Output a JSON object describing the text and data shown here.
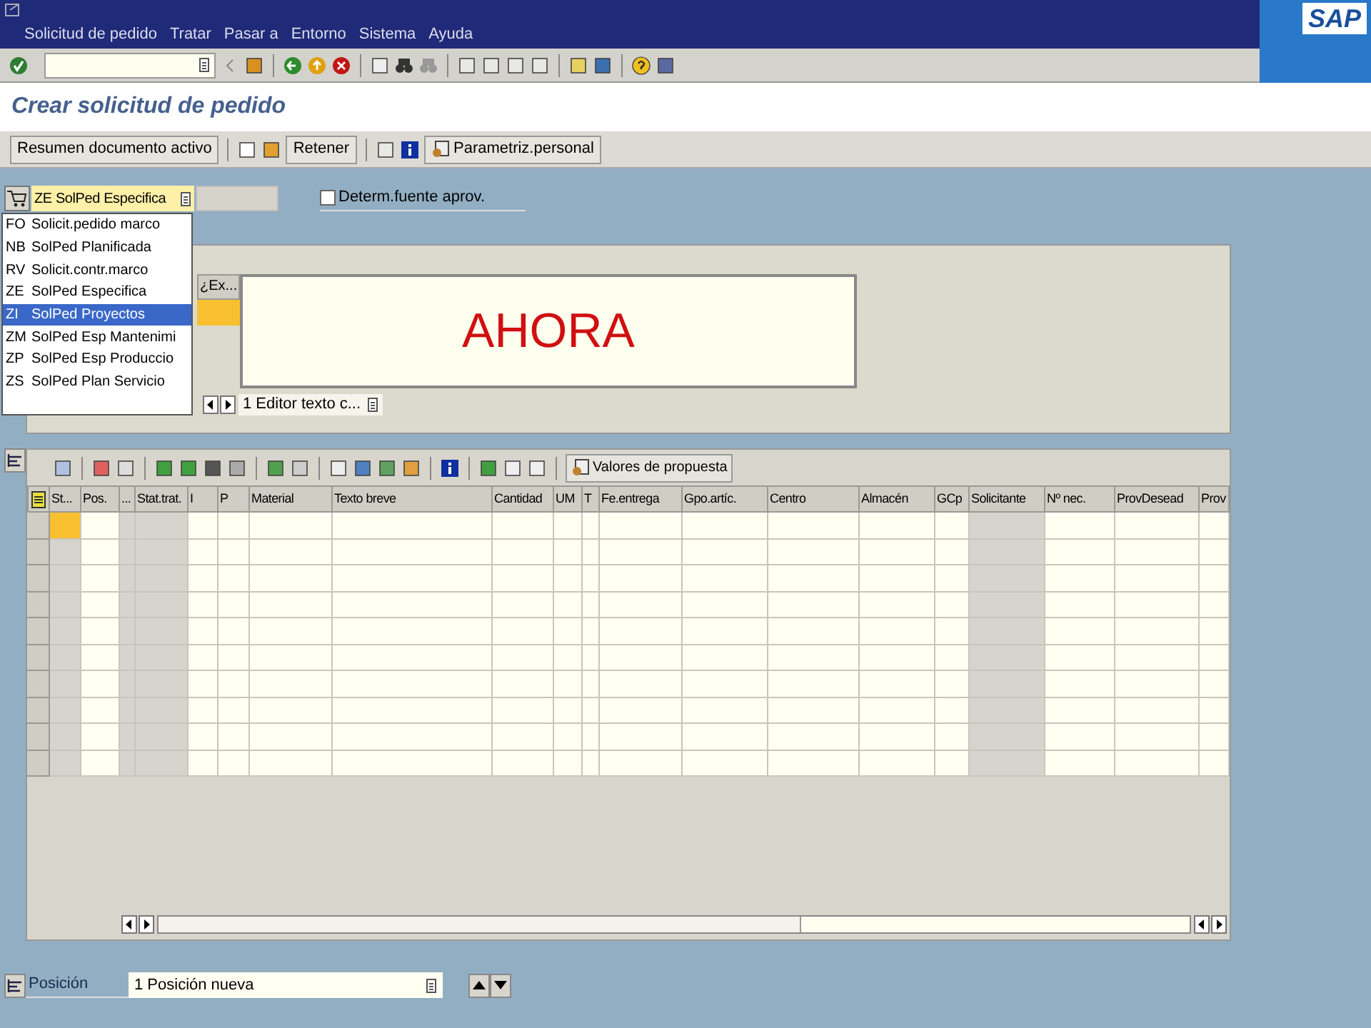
{
  "logo": "SAP",
  "menu": [
    {
      "label": "Solicitud de pedido"
    },
    {
      "label": "Tratar"
    },
    {
      "label": "Pasar a"
    },
    {
      "label": "Entorno"
    },
    {
      "label": "Sistema"
    },
    {
      "label": "Ayuda"
    }
  ],
  "title": "Crear solicitud de pedido",
  "app_toolbar": {
    "summary_button": "Resumen documento activo",
    "hold_button": "Retener",
    "settings_button": "Parametriz.personal"
  },
  "doc_type": {
    "value": "ZE SolPed Especifica",
    "expanded": true,
    "options": [
      {
        "code": "FO",
        "label": "Solicit.pedido marco",
        "selected": false
      },
      {
        "code": "NB",
        "label": "SolPed Planificada",
        "selected": false
      },
      {
        "code": "RV",
        "label": "Solicit.contr.marco",
        "selected": false
      },
      {
        "code": "ZE",
        "label": "SolPed Especifica",
        "selected": false
      },
      {
        "code": "ZI",
        "label": "SolPed Proyectos",
        "selected": true
      },
      {
        "code": "ZM",
        "label": "SolPed Esp Mantenimi",
        "selected": false
      },
      {
        "code": "ZP",
        "label": "SolPed Esp Produccio",
        "selected": false
      },
      {
        "code": "ZS",
        "label": "SolPed Plan Servicio",
        "selected": false
      }
    ]
  },
  "source_checkbox": {
    "label": "Determ.fuente aprov.",
    "checked": false
  },
  "header_texts": {
    "column": "¿Ex...",
    "editor_text": "AHORA",
    "text_selector": "1 Editor texto c..."
  },
  "items": {
    "proposal_button": "Valores de propuesta",
    "columns": [
      {
        "label": "St...",
        "shaded": true,
        "first_cell_focused": true
      },
      {
        "label": "Pos.",
        "shaded": false,
        "first_cell_focused": false
      },
      {
        "label": "...",
        "shaded": true,
        "first_cell_focused": false
      },
      {
        "label": "Stat.trat.",
        "shaded": true,
        "first_cell_focused": false
      },
      {
        "label": "I",
        "shaded": false,
        "first_cell_focused": false
      },
      {
        "label": "P",
        "shaded": false,
        "first_cell_focused": false
      },
      {
        "label": "Material",
        "shaded": false,
        "first_cell_focused": false
      },
      {
        "label": "Texto breve",
        "shaded": false,
        "first_cell_focused": false
      },
      {
        "label": "Cantidad",
        "shaded": false,
        "first_cell_focused": false
      },
      {
        "label": "UM",
        "shaded": false,
        "first_cell_focused": false
      },
      {
        "label": "T",
        "shaded": false,
        "first_cell_focused": false
      },
      {
        "label": "Fe.entrega",
        "shaded": false,
        "first_cell_focused": false
      },
      {
        "label": "Gpo.artíc.",
        "shaded": false,
        "first_cell_focused": false
      },
      {
        "label": "Centro",
        "shaded": false,
        "first_cell_focused": false
      },
      {
        "label": "Almacén",
        "shaded": false,
        "first_cell_focused": false
      },
      {
        "label": "GCp",
        "shaded": false,
        "first_cell_focused": false
      },
      {
        "label": "Solicitante",
        "shaded": true,
        "first_cell_focused": false
      },
      {
        "label": "Nº nec.",
        "shaded": false,
        "first_cell_focused": false
      },
      {
        "label": "ProvDesead",
        "shaded": false,
        "first_cell_focused": false
      },
      {
        "label": "Prov",
        "shaded": false,
        "first_cell_focused": false
      }
    ]
  },
  "position": {
    "label": "Posición",
    "value": "1 Posición nueva"
  }
}
